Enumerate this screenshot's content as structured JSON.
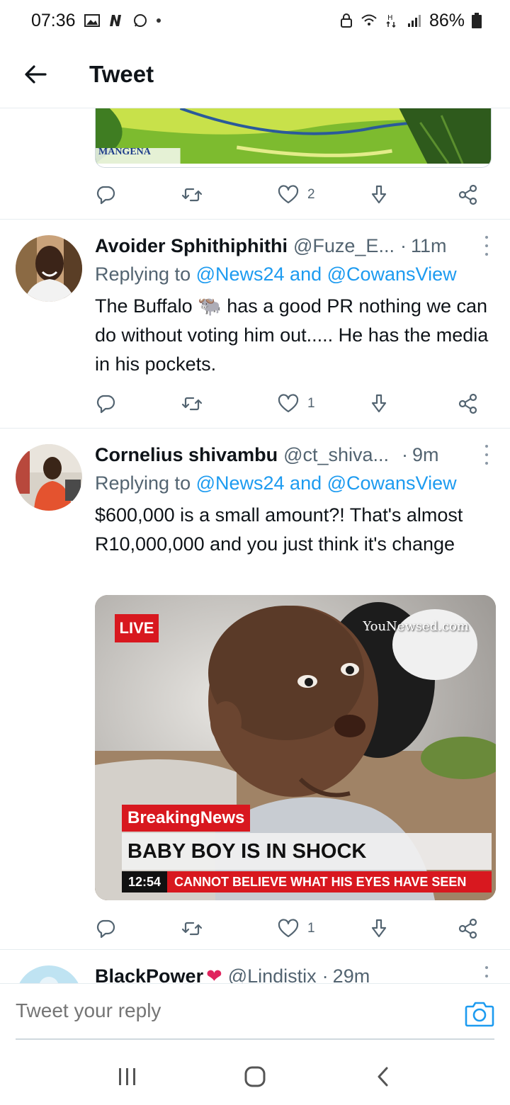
{
  "status_bar": {
    "time": "07:36",
    "battery": "86%"
  },
  "header": {
    "title": "Tweet"
  },
  "top_tweet": {
    "image_caption": "MANGENA",
    "likes": "2"
  },
  "tweets": [
    {
      "name": "Avoider Sphithiphithi",
      "handle": "@Fuze_E...",
      "separator": "·",
      "time": "11m",
      "replying_prefix": "Replying to ",
      "mentions": "@News24 and @CowansView",
      "body_before": "The Buffalo ",
      "emoji": "🐃",
      "body_after": " has a good PR nothing we can do without voting him out..... He has the media in his pockets.",
      "likes": "1"
    },
    {
      "name": "Cornelius shivambu",
      "handle": "@ct_shiva...",
      "separator": "·",
      "time": "9m",
      "replying_prefix": "Replying to ",
      "mentions": "@News24 and @CowansView",
      "body": "$600,000 is a small amount?!  That's almost R10,000,000  and you just think it's change",
      "likes": "1",
      "media": {
        "live": "LIVE",
        "watermark": "YouNewsed.com",
        "tag": "BreakingNews",
        "headline": "BABY BOY IS IN SHOCK",
        "ticker_time": "12:54",
        "ticker_text": "CANNOT BELIEVE WHAT HIS EYES HAVE SEEN"
      }
    },
    {
      "name": "BlackPower",
      "emoji": "❤",
      "handle": "@Lindistix",
      "separator": "·",
      "time": "29m"
    }
  ],
  "compose": {
    "placeholder": "Tweet your reply"
  },
  "colors": {
    "link": "#1d9bf0",
    "muted": "#536471",
    "live_red": "#d8181f"
  }
}
